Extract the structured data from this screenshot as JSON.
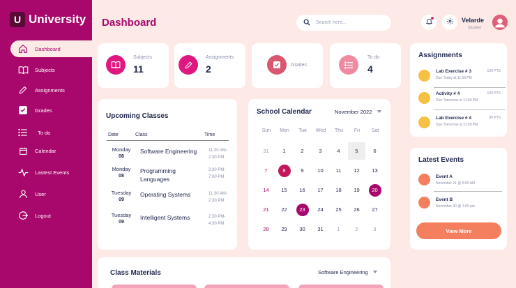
{
  "app": {
    "logo_letter": "U",
    "logo_text": "University"
  },
  "sidebar": {
    "items": [
      {
        "label": "Dashboard",
        "icon": "home-icon"
      },
      {
        "label": "Subjects",
        "icon": "book-icon"
      },
      {
        "label": "Assignments",
        "icon": "pencil-icon"
      },
      {
        "label": "Grades",
        "icon": "checkbox-icon"
      },
      {
        "label": "To do",
        "icon": "list-icon"
      },
      {
        "label": "Calendar",
        "icon": "calendar-icon"
      },
      {
        "label": "Lastest Events",
        "icon": "activity-icon"
      },
      {
        "label": "User",
        "icon": "user-icon"
      },
      {
        "label": "Logout",
        "icon": "logout-icon"
      }
    ],
    "active": "Dashboard"
  },
  "header": {
    "title": "Dashboard",
    "search_placeholder": "Search here...",
    "user_name": "Velarde",
    "user_role": "Student"
  },
  "stats": [
    {
      "label": "Subjects",
      "value": "11",
      "icon": "book-icon",
      "color": "#e0177f"
    },
    {
      "label": "Assignments",
      "value": "2",
      "icon": "pencil-icon",
      "color": "#e0177f"
    },
    {
      "label": "Grades",
      "value": "",
      "icon": "checkbox-icon",
      "color": "#d9576f"
    },
    {
      "label": "To do",
      "value": "4",
      "icon": "list-icon",
      "color": "#f08aa0"
    }
  ],
  "upcoming": {
    "title": "Upcoming Classes",
    "headers": {
      "date": "Date",
      "class": "Class",
      "time": "Time"
    },
    "rows": [
      {
        "day": "Monday",
        "date": "08",
        "course": "Software Engineering",
        "start": "11:30 AM-",
        "end": "2:30 PM"
      },
      {
        "day": "Monday",
        "date": "08",
        "course": "Programming Languages",
        "start": "3:30 PM-",
        "end": "7:00 PM"
      },
      {
        "day": "Tuesday",
        "date": "09",
        "course": "Operating Systems",
        "start": "11:30 AM-",
        "end": "2:30 PM"
      },
      {
        "day": "Tuesday",
        "date": "09",
        "course": "Intelligent Systems",
        "start": "2:30 PM-",
        "end": "4:30 PM"
      }
    ]
  },
  "calendar": {
    "title": "School Calendar",
    "month": "November 2022",
    "dow": [
      "Sun",
      "Mon",
      "Tue",
      "Wed",
      "Thu",
      "Fri",
      "Sat"
    ],
    "weeks": [
      [
        "31",
        "1",
        "2",
        "3",
        "4",
        "5",
        "6"
      ],
      [
        "7",
        "8",
        "9",
        "10",
        "11",
        "12",
        "13"
      ],
      [
        "14",
        "15",
        "16",
        "17",
        "18",
        "19",
        "20"
      ],
      [
        "21",
        "22",
        "23",
        "24",
        "25",
        "26",
        "27"
      ],
      [
        "28",
        "29",
        "30",
        "31",
        "1",
        "2",
        "3"
      ]
    ],
    "marked": {
      "8": "#c2185b",
      "20": "#a8086b",
      "23": "#a8086b"
    },
    "today": "5",
    "colors": {
      "sunday": "#a8086b",
      "muted": "#9aa0b8"
    }
  },
  "assignments": {
    "title": "Assignments",
    "items": [
      {
        "title": "Lab Exercise # 3",
        "due": "Due Today at 11:59 PM",
        "points": "100 PTS"
      },
      {
        "title": "Activity # 4",
        "due": "Due Tomorrow at 11:59 PM",
        "points": "100 PTS"
      },
      {
        "title": "Lab Exercise # 4",
        "due": "Due Tomorrow at 11:59 PM",
        "points": "80 PTS"
      }
    ]
  },
  "events": {
    "title": "Latest Events",
    "items": [
      {
        "title": "Event A",
        "date": "November 21 @ 8:00 AM"
      },
      {
        "title": "Event B",
        "date": "November 30 @ 1:00 pm"
      }
    ],
    "button_label": "View More"
  },
  "materials": {
    "title": "Class Materials",
    "selected": "Software Engineering"
  }
}
